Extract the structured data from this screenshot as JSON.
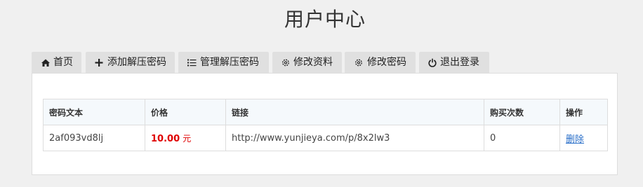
{
  "page_title": "用户中心",
  "tabs": [
    {
      "label": "首页",
      "icon": "home-icon"
    },
    {
      "label": "添加解压密码",
      "icon": "plus-icon"
    },
    {
      "label": "管理解压密码",
      "icon": "list-icon"
    },
    {
      "label": "修改资料",
      "icon": "gear-icon"
    },
    {
      "label": "修改密码",
      "icon": "gear-icon"
    },
    {
      "label": "退出登录",
      "icon": "power-icon"
    }
  ],
  "table": {
    "headers": [
      "密码文本",
      "价格",
      "链接",
      "购买次数",
      "操作"
    ],
    "rows": [
      {
        "password_text": "2af093vd8lj",
        "price": "10.00",
        "price_unit": "元",
        "link": "http://www.yunjieya.com/p/8x2lw3",
        "purchase_count": "0",
        "action": "删除"
      }
    ]
  },
  "colors": {
    "background": "#f0f0f0",
    "tab_background": "#e0e0e0",
    "price": "#e00000",
    "link": "#2a6fc9",
    "header_background": "#f5f9fc"
  }
}
